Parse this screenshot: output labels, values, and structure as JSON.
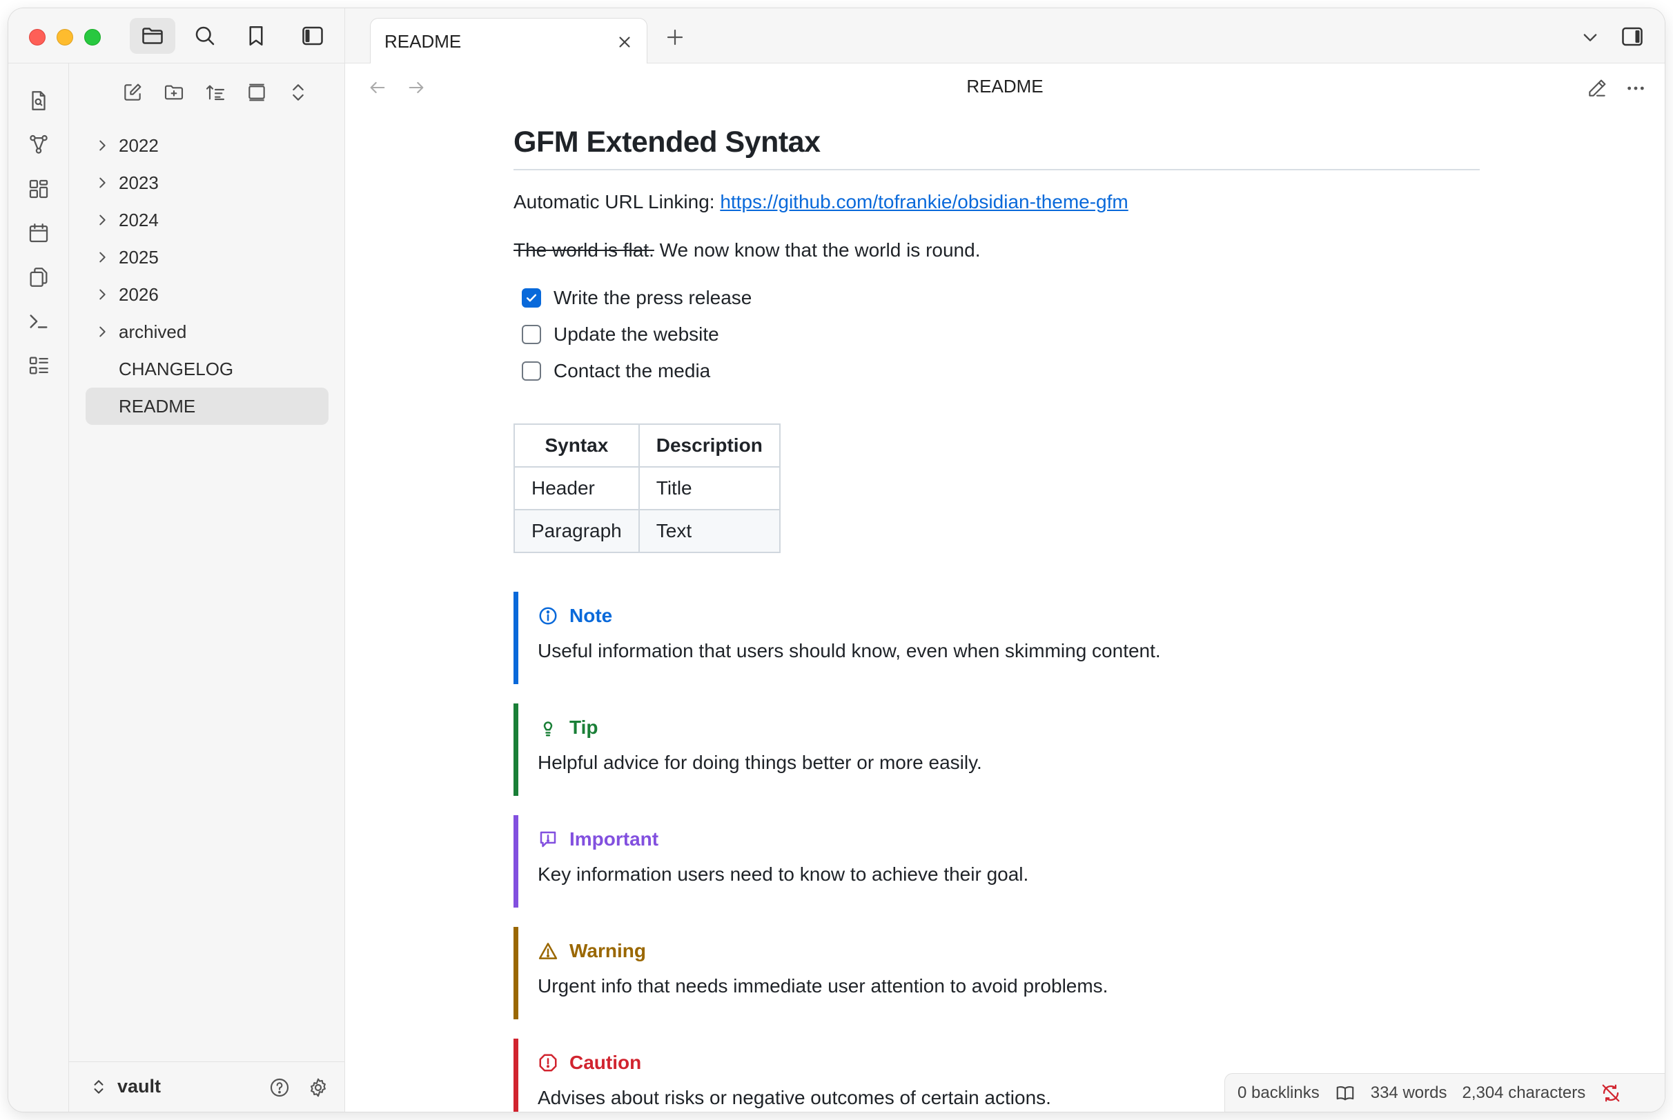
{
  "app": {
    "vault_name": "vault"
  },
  "explorer": {
    "items": [
      {
        "label": "2022",
        "type": "folder"
      },
      {
        "label": "2023",
        "type": "folder"
      },
      {
        "label": "2024",
        "type": "folder"
      },
      {
        "label": "2025",
        "type": "folder"
      },
      {
        "label": "2026",
        "type": "folder"
      },
      {
        "label": "archived",
        "type": "folder"
      },
      {
        "label": "CHANGELOG",
        "type": "file"
      },
      {
        "label": "README",
        "type": "file",
        "selected": true
      }
    ],
    "toolbar_icons": [
      "new-note-icon",
      "new-folder-icon",
      "sort-icon",
      "collapse-icon",
      "expand-icon"
    ]
  },
  "ribbon": {
    "icons": [
      "search-file-icon",
      "graph-icon",
      "canvas-icon",
      "calendar-icon",
      "copy-icon",
      "terminal-icon",
      "outline-icon"
    ]
  },
  "tabs": [
    {
      "label": "README",
      "active": true
    }
  ],
  "view": {
    "title": "README"
  },
  "note": {
    "heading": "GFM Extended Syntax",
    "autolink_label": "Automatic URL Linking: ",
    "autolink_url": "https://github.com/tofrankie/obsidian-theme-gfm",
    "strike_text": "The world is flat.",
    "after_strike": " We now know that the world is round.",
    "tasks": [
      {
        "text": "Write the press release",
        "checked": true
      },
      {
        "text": "Update the website",
        "checked": false
      },
      {
        "text": "Contact the media",
        "checked": false
      }
    ],
    "table": {
      "headers": [
        "Syntax",
        "Description"
      ],
      "rows": [
        [
          "Header",
          "Title"
        ],
        [
          "Paragraph",
          "Text"
        ]
      ]
    },
    "callouts": [
      {
        "type": "note",
        "title": "Note",
        "body": "Useful information that users should know, even when skimming content.",
        "color": "#0969da"
      },
      {
        "type": "tip",
        "title": "Tip",
        "body": "Helpful advice for doing things better or more easily.",
        "color": "#1a7f37"
      },
      {
        "type": "important",
        "title": "Important",
        "body": "Key information users need to know to achieve their goal.",
        "color": "#8250df"
      },
      {
        "type": "warning",
        "title": "Warning",
        "body": "Urgent info that needs immediate user attention to avoid problems.",
        "color": "#9a6700"
      },
      {
        "type": "caution",
        "title": "Caution",
        "body": "Advises about risks or negative outcomes of certain actions.",
        "color": "#d1242f"
      }
    ]
  },
  "status_bar": {
    "backlinks": "0 backlinks",
    "words": "334 words",
    "characters": "2,304 characters"
  }
}
